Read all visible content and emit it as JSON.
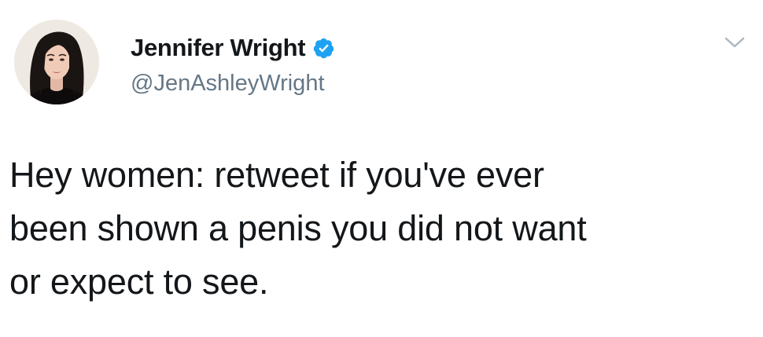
{
  "tweet": {
    "author": {
      "display_name": "Jennifer Wright",
      "handle": "@JenAshleyWright",
      "verified": true,
      "verified_color": "#1da1f2"
    },
    "text": "Hey women: retweet if you've ever\nbeen shown a penis you did not want\nor expect to see.",
    "icons": {
      "avatar": "profile-photo",
      "badge": "verified-badge-icon",
      "menu": "chevron-down-icon"
    }
  }
}
